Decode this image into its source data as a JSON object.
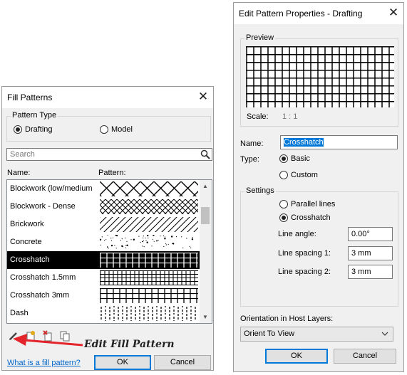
{
  "fill_patterns": {
    "title": "Fill Patterns",
    "pattern_type": {
      "legend": "Pattern Type",
      "drafting_label": "Drafting",
      "model_label": "Model",
      "selected": "Drafting"
    },
    "search_placeholder": "Search",
    "columns": {
      "name": "Name:",
      "pattern": "Pattern:"
    },
    "rows": [
      {
        "name": "Blockwork (low/medium",
        "pattern": "diamond-large",
        "selected": false
      },
      {
        "name": "Blockwork - Dense",
        "pattern": "diamond-dense",
        "selected": false
      },
      {
        "name": "Brickwork",
        "pattern": "diagonal-lines",
        "selected": false
      },
      {
        "name": "Concrete",
        "pattern": "concrete-dots",
        "selected": false
      },
      {
        "name": "Crosshatch",
        "pattern": "grid",
        "selected": true
      },
      {
        "name": "Crosshatch 1.5mm",
        "pattern": "grid-fine",
        "selected": false
      },
      {
        "name": "Crosshatch 3mm",
        "pattern": "grid",
        "selected": false
      },
      {
        "name": "Dash",
        "pattern": "dash",
        "selected": false
      }
    ],
    "toolbar_icons": [
      "edit-pencil-icon",
      "new-pattern-icon",
      "delete-pattern-icon",
      "duplicate-pattern-icon"
    ],
    "help_link": "What is a fill pattern?",
    "ok_label": "OK",
    "cancel_label": "Cancel"
  },
  "annotation": {
    "text": "Edit Fill Pattern",
    "color": "#e3242b"
  },
  "edit_pattern": {
    "title": "Edit Pattern Properties - Drafting",
    "preview_legend": "Preview",
    "scale_label": "Scale:",
    "scale_value": "1 : 1",
    "name_label": "Name:",
    "name_value": "Crosshatch",
    "type_label": "Type:",
    "type_basic": "Basic",
    "type_custom": "Custom",
    "type_selected": "Basic",
    "settings_legend": "Settings",
    "parallel_label": "Parallel lines",
    "crosshatch_label": "Crosshatch",
    "settings_selected": "Crosshatch",
    "line_angle_label": "Line angle:",
    "line_angle_value": "0.00°",
    "spacing1_label": "Line spacing 1:",
    "spacing1_value": "3 mm",
    "spacing2_label": "Line spacing 2:",
    "spacing2_value": "3 mm",
    "orientation_label": "Orientation in Host Layers:",
    "orientation_value": "Orient To View",
    "ok_label": "OK",
    "cancel_label": "Cancel"
  },
  "colors": {
    "accent": "#0078d7",
    "selection": "#000000",
    "link": "#0066cc",
    "arrow": "#e3242b"
  }
}
